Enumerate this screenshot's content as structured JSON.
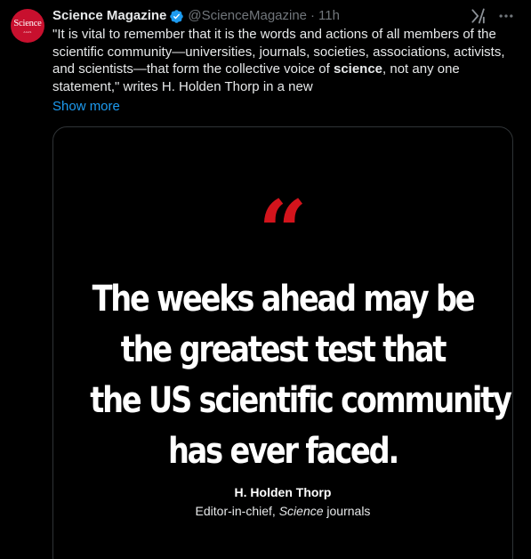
{
  "tweet": {
    "avatar_text": "Science",
    "avatar_subtext": "AAAS",
    "display_name": "Science Magazine",
    "handle": "@ScienceMagazine",
    "separator": "·",
    "time": "11h",
    "text_part1": "\"It is vital to remember that it is the words and actions of all members of the scientific community—universities, journals, societies, associations, activists, and scientists—that form the collective voice of ",
    "text_bold": "science",
    "text_part2": ", not any one statement,\" writes H. Holden Thorp in a new",
    "show_more": "Show more"
  },
  "media": {
    "quote_mark": "“",
    "headline_lines": [
      "The weeks ahead may be",
      "the greatest test that",
      "the US scientific community",
      "has ever faced."
    ],
    "author": "H. Holden Thorp",
    "author_title_prefix": "Editor-in-chief, ",
    "author_title_italic": "Science",
    "author_title_suffix": " journals"
  },
  "icons": {
    "verified": "verified-badge-icon",
    "grok": "grok-icon",
    "more": "more-options-icon"
  },
  "colors": {
    "background": "#000000",
    "text": "#e7e9ea",
    "muted": "#71767b",
    "link": "#1d9bf0",
    "verified": "#1d9bf0",
    "avatar": "#c8102e",
    "quote_mark": "#d3141c",
    "card_border": "#2f3336"
  }
}
